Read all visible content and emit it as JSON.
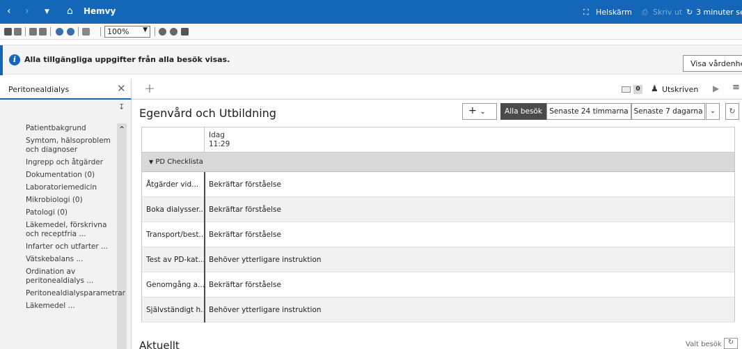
{
  "titlebar": {
    "title": "Hemvy",
    "fullscreen_label": "Helskärm",
    "print_label": "Skriv ut",
    "refresh_label": "3 minuter se"
  },
  "toolbar": {
    "zoom_value": "100%"
  },
  "banner": {
    "text": "Alla tillgängliga uppgifter från alla besök visas.",
    "button_label": "Visa vårdenhete"
  },
  "tabs": {
    "active_tab": "Peritonealdialys",
    "count": "0",
    "status_label": "Utskriven"
  },
  "sidebar": {
    "items": [
      "Patientbakgrund",
      "Symtom, hälsoproblem och diagnoser",
      "Ingrepp och åtgärder",
      "Dokumentation (0)",
      "Laboratoriemedicin",
      "Mikrobiologi (0)",
      "Patologi (0)",
      "Läkemedel, förskrivna och receptfria ...",
      "Infarter och utfarter ...",
      "Vätskebalans ...",
      "Ordination av peritonealdialys ...",
      "Peritonealdialysparametrar",
      "Läkemedel ..."
    ]
  },
  "main": {
    "title": "Egenvård och Utbildning",
    "filters": [
      "Alla besök",
      "Senaste 24 timmarna",
      "Senaste 7 dagarna"
    ],
    "column_header_day": "Idag",
    "column_header_time": "11:29",
    "section_label": "PD Checklista",
    "rows": [
      {
        "name": "Åtgärder vid...",
        "value": "Bekräftar förståelse"
      },
      {
        "name": "Boka dialysser...",
        "value": "Bekräftar förståelse"
      },
      {
        "name": "Transport/best...",
        "value": "Bekräftar förståelse"
      },
      {
        "name": "Test av PD-kat...",
        "value": "Behöver ytterligare instruktion"
      },
      {
        "name": "Genomgång a...",
        "value": "Bekräftar förståelse"
      },
      {
        "name": "Självständigt h...",
        "value": "Behöver ytterligare instruktion"
      }
    ]
  },
  "bottom": {
    "title": "Aktuellt",
    "valt_besok": "Valt besök"
  },
  "colors": {
    "titlebar": "#1466b8",
    "active_filter": "#4a4a4a",
    "section_row": "#d9d9d9"
  }
}
